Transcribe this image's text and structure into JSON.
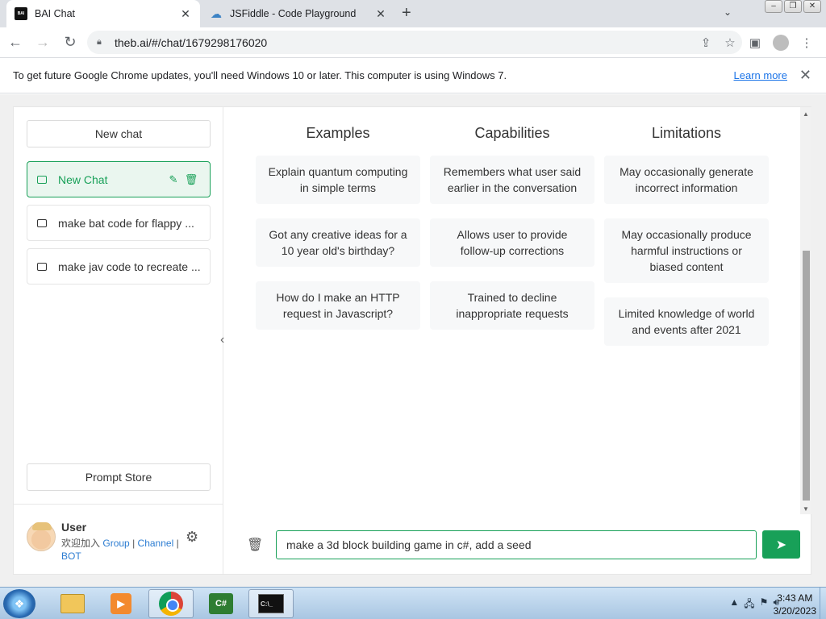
{
  "browser": {
    "tabs": [
      {
        "title": "BAI Chat",
        "active": true
      },
      {
        "title": "JSFiddle - Code Playground",
        "active": false
      }
    ],
    "url": "theb.ai/#/chat/1679298176020",
    "infobar": {
      "message": "To get future Google Chrome updates, you'll need Windows 10 or later. This computer is using Windows 7.",
      "link": "Learn more"
    }
  },
  "sidebar": {
    "new_chat_label": "New chat",
    "chats": [
      {
        "label": "New Chat",
        "active": true
      },
      {
        "label": "make bat code for flappy ...",
        "active": false
      },
      {
        "label": "make jav code to recreate ...",
        "active": false
      }
    ],
    "prompt_store_label": "Prompt Store",
    "user": {
      "name": "User",
      "join_text": "欢迎加入",
      "links": [
        "Group",
        "Channel",
        "BOT"
      ],
      "separator": "|"
    }
  },
  "main": {
    "columns": [
      {
        "title": "Examples",
        "items": [
          "Explain quantum computing in simple terms",
          "Got any creative ideas for a 10 year old's birthday?",
          "How do I make an HTTP request in Javascript?"
        ]
      },
      {
        "title": "Capabilities",
        "items": [
          "Remembers what user said earlier in the conversation",
          "Allows user to provide follow-up corrections",
          "Trained to decline inappropriate requests"
        ]
      },
      {
        "title": "Limitations",
        "items": [
          "May occasionally generate incorrect information",
          "May occasionally produce harmful instructions or biased content",
          "Limited knowledge of world and events after 2021"
        ]
      }
    ],
    "input_value": "make a 3d block building game in c#, add a seed"
  },
  "taskbar": {
    "time": "3:43 AM",
    "date": "3/20/2023",
    "cs_label": "C#",
    "cmd_label": "C:\\_"
  },
  "colors": {
    "accent": "#18a058",
    "link": "#2d7dd2"
  }
}
